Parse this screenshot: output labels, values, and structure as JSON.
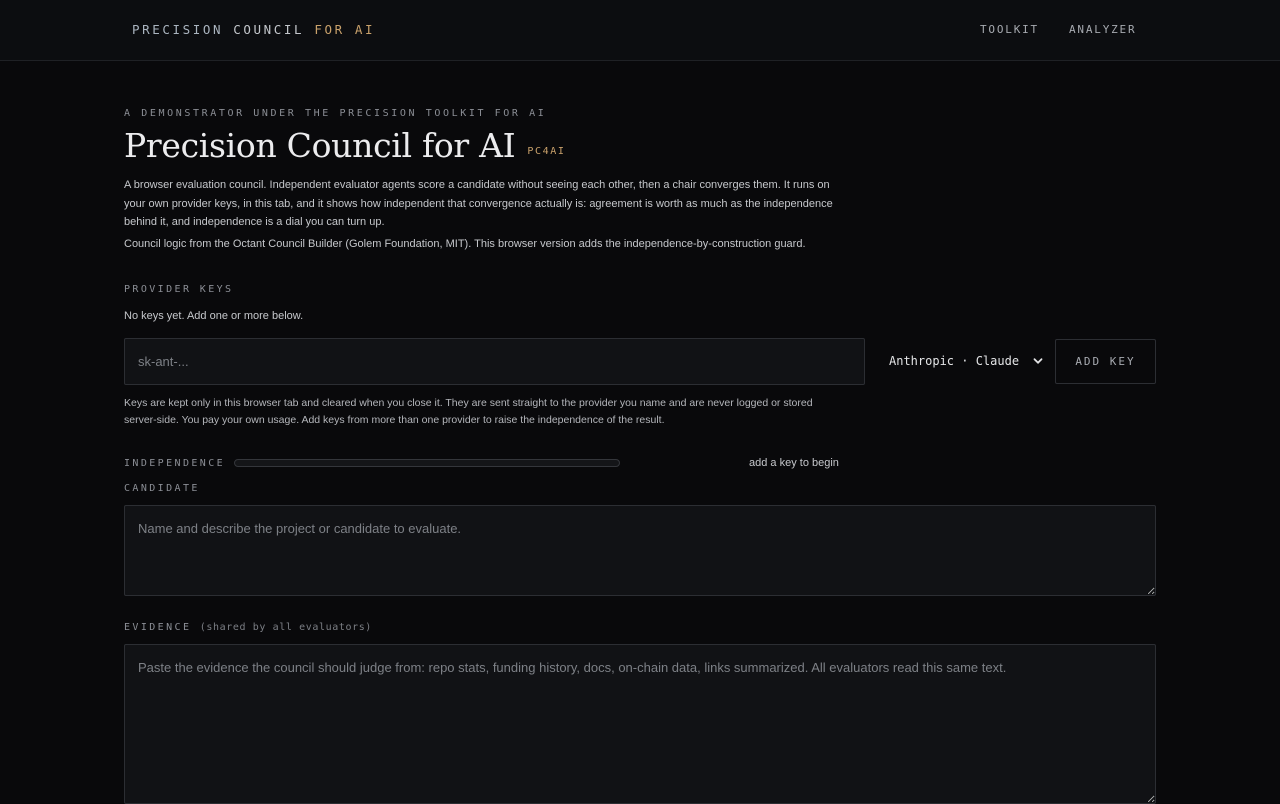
{
  "header": {
    "brand": {
      "part1": "PRECISION",
      "part2": "COUNCIL",
      "part3": "FOR AI"
    },
    "nav": [
      {
        "label": "TOOLKIT"
      },
      {
        "label": "ANALYZER"
      }
    ]
  },
  "hero": {
    "eyebrow": "A DEMONSTRATOR UNDER THE PRECISION TOOLKIT FOR AI",
    "title": "Precision Council for AI",
    "badge": "PC4AI",
    "description": "A browser evaluation council. Independent evaluator agents score a candidate without seeing each other, then a chair converges them. It runs on your own provider keys, in this tab, and it shows how independent that convergence actually is: agreement is worth as much as the independence behind it, and independence is a dial you can turn up.",
    "credit": "Council logic from the Octant Council Builder (Golem Foundation, MIT). This browser version adds the independence-by-construction guard."
  },
  "provider_keys": {
    "label": "PROVIDER KEYS",
    "empty_state": "No keys yet. Add one or more below.",
    "input_placeholder": "sk-ant-...",
    "selected_provider": "Anthropic · Claude",
    "add_button": "ADD KEY",
    "note": "Keys are kept only in this browser tab and cleared when you close it. They are sent straight to the provider you name and are never logged or stored server-side. You pay your own usage. Add keys from more than one provider to raise the independence of the result."
  },
  "independence": {
    "label": "INDEPENDENCE",
    "level": 0,
    "status": "add a key to begin",
    "fill_color": "#c9a16b"
  },
  "candidate": {
    "label": "CANDIDATE",
    "placeholder": "Name and describe the project or candidate to evaluate."
  },
  "evidence": {
    "label": "EVIDENCE",
    "sublabel": "(shared by all evaluators)",
    "placeholder": "Paste the evidence the council should judge from: repo stats, funding history, docs, on-chain data, links summarized. All evaluators read this same text."
  },
  "colors": {
    "background": "#09090b",
    "accent": "#c9a16b"
  }
}
